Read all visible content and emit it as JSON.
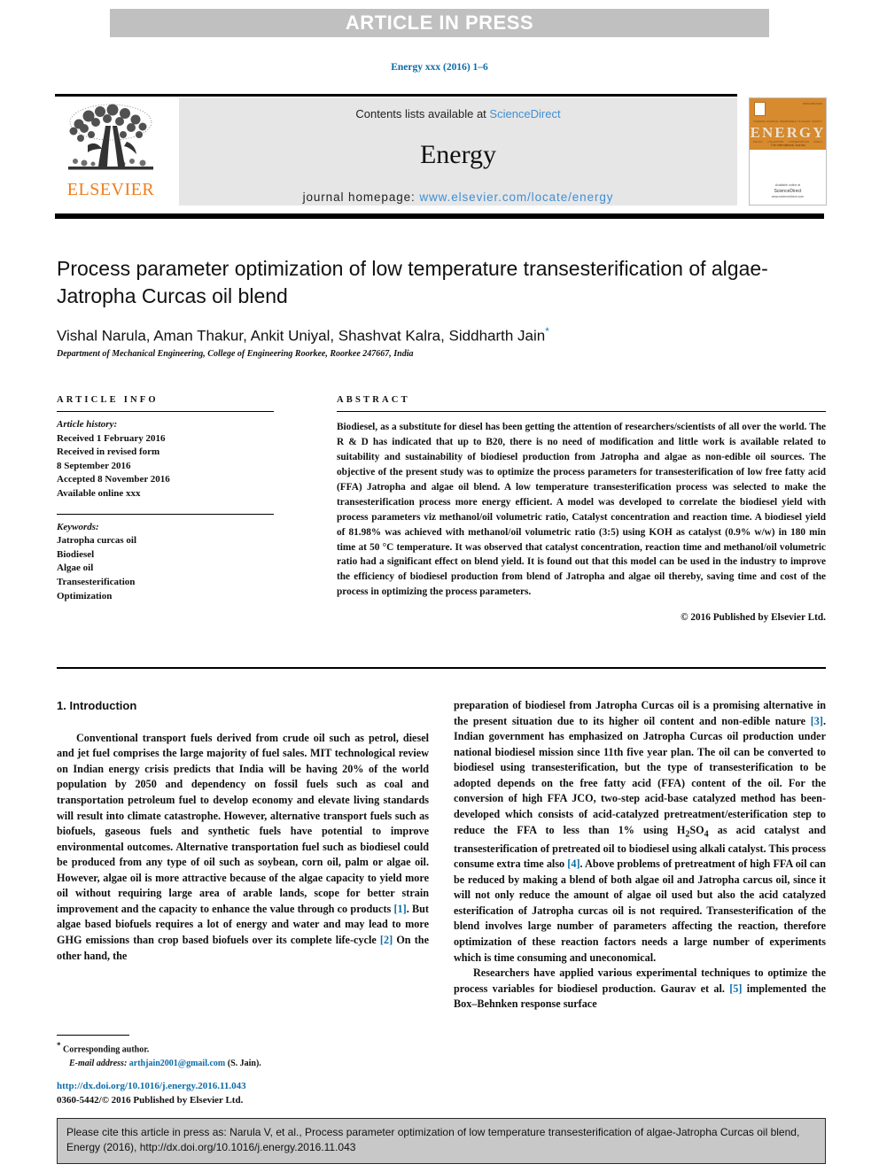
{
  "banner": {
    "label": "ARTICLE IN PRESS"
  },
  "running_head": {
    "text": "Energy xxx (2016) 1–6"
  },
  "journal_header": {
    "contents_prefix": "Contents lists available at ",
    "sciencedirect_link": "ScienceDirect",
    "journal_title": "Energy",
    "homepage_prefix": "journal homepage: ",
    "homepage_url": "www.elsevier.com/locate/energy",
    "publisher_logo_text": "ELSEVIER",
    "link_color": "#3f8fd4",
    "elsevier_orange": "#ef7d1a"
  },
  "cover": {
    "title": "ENERGY",
    "subtitle": "The International Journal",
    "issn": "ISSN 0360-5442",
    "topics": [
      "THERMAL SCIENCE",
      "RENEWABLE",
      "NUCLEAR",
      "SUPPLY"
    ],
    "topics2": [
      "POLICY",
      "UTILIZATION",
      "CONSERVATION",
      "FUELS"
    ],
    "footer_big": "Available online at",
    "footer_small": "ScienceDirect",
    "footer_url": "www.sciencedirect.com",
    "header_color": "#d78a2e"
  },
  "article": {
    "title": "Process parameter optimization of low temperature transesterification of algae-Jatropha Curcas oil blend",
    "authors": "Vishal Narula, Aman Thakur, Ankit Uniyal, Shashvat Kalra, Siddharth Jain",
    "author_marker": "*",
    "affiliation": "Department of Mechanical Engineering, College of Engineering Roorkee, Roorkee 247667, India"
  },
  "article_info": {
    "heading": "ARTICLE INFO",
    "history_label": "Article history:",
    "history_lines": [
      "Received 1 February 2016",
      "Received in revised form",
      "8 September 2016",
      "Accepted 8 November 2016",
      "Available online xxx"
    ],
    "keywords_label": "Keywords:",
    "keywords": [
      "Jatropha curcas oil",
      "Biodiesel",
      "Algae oil",
      "Transesterification",
      "Optimization"
    ]
  },
  "abstract": {
    "heading": "ABSTRACT",
    "text": "Biodiesel, as a substitute for diesel has been getting the attention of researchers/scientists of all over the world. The R & D has indicated that up to B20, there is no need of modification and little work is available related to suitability and sustainability of biodiesel production from Jatropha and algae as non-edible oil sources. The objective of the present study was to optimize the process parameters for transesterification of low free fatty acid (FFA) Jatropha and algae oil blend. A low temperature transesterification process was selected to make the transesterification process more energy efficient. A model was developed to correlate the biodiesel yield with process parameters viz methanol/oil volumetric ratio, Catalyst concentration and reaction time. A biodiesel yield of 81.98% was achieved with methanol/oil volumetric ratio (3:5) using KOH as catalyst (0.9% w/w) in 180 min time at 50 °C temperature. It was observed that catalyst concentration, reaction time and methanol/oil volumetric ratio had a significant effect on blend yield. It is found out that this model can be used in the industry to improve the efficiency of biodiesel production from blend of Jatropha and algae oil thereby, saving time and cost of the process in optimizing the process parameters.",
    "copyright": "© 2016 Published by Elsevier Ltd."
  },
  "body": {
    "section_title": "1. Introduction",
    "left_paragraph_1": "Conventional transport fuels derived from crude oil such as petrol, diesel and jet fuel comprises the large majority of fuel sales. MIT technological review on Indian energy crisis predicts that India will be having 20% of the world population by 2050 and dependency on fossil fuels such as coal and transportation petroleum fuel to develop economy and elevate living standards will result into climate catastrophe. However, alternative transport fuels such as biofuels, gaseous fuels and synthetic fuels have potential to improve environmental outcomes. Alternative transportation fuel such as biodiesel could be produced from any type of oil such as soybean, corn oil, palm or algae oil. However, algae oil is more attractive because of the algae capacity to yield more oil without requiring large area of arable lands, scope for better strain improvement and the capacity to enhance the value through co products ",
    "left_ref_1": "[1]",
    "left_paragraph_1b": ". But algae based biofuels requires a lot of energy and water and may lead to more GHG emissions than crop based biofuels over its complete life-cycle ",
    "left_ref_2": "[2]",
    "left_paragraph_1c": " On the other hand, the",
    "right_paragraph_1": "preparation of biodiesel from Jatropha Curcas oil is a promising alternative in the present situation due to its higher oil content and non-edible nature ",
    "right_ref_3": "[3]",
    "right_paragraph_1b": ". Indian government has emphasized on Jatropha Curcas oil production under national biodiesel mission since 11th five year plan. The oil can be converted to biodiesel using transesterification, but the type of transesterification to be adopted depends on the free fatty acid (FFA) content of the oil. For the conversion of high FFA JCO, two-step acid-base catalyzed method has been-developed which consists of acid-catalyzed pretreatment/esterification step to reduce the FFA to less than 1% using H",
    "right_sub_2": "2",
    "right_paragraph_1c": "SO",
    "right_sub_4": "4",
    "right_paragraph_1d": " as acid catalyst and transesterification of pretreated oil to biodiesel using alkali catalyst. This process consume extra time also ",
    "right_ref_4": "[4]",
    "right_paragraph_1e": ". Above problems of pretreatment of high FFA oil can be reduced by making a blend of both algae oil and Jatropha carcus oil, since it will not only reduce the amount of algae oil used but also the acid catalyzed esterification of Jatropha curcas oil is not required. Transesterification of the blend involves large number of parameters affecting the reaction, therefore optimization of these reaction factors needs a large number of experiments which is time consuming and uneconomical.",
    "right_paragraph_2": "Researchers have applied various experimental techniques to optimize the process variables for biodiesel production. Gaurav et al. ",
    "right_ref_5": "[5]",
    "right_paragraph_2b": " implemented the Box–Behnken response surface"
  },
  "footnote": {
    "marker": "*",
    "corresponding": "Corresponding author.",
    "email_label": "E-mail address:",
    "email": "arthjain2001@gmail.com",
    "email_attrib": "(S. Jain)."
  },
  "doi_block": {
    "doi": "http://dx.doi.org/10.1016/j.energy.2016.11.043",
    "issn_line": "0360-5442/© 2016 Published by Elsevier Ltd."
  },
  "citation_box": {
    "text": "Please cite this article in press as: Narula V, et al., Process parameter optimization of low temperature transesterification of algae-Jatropha Curcas oil blend, Energy (2016), http://dx.doi.org/10.1016/j.energy.2016.11.043"
  }
}
